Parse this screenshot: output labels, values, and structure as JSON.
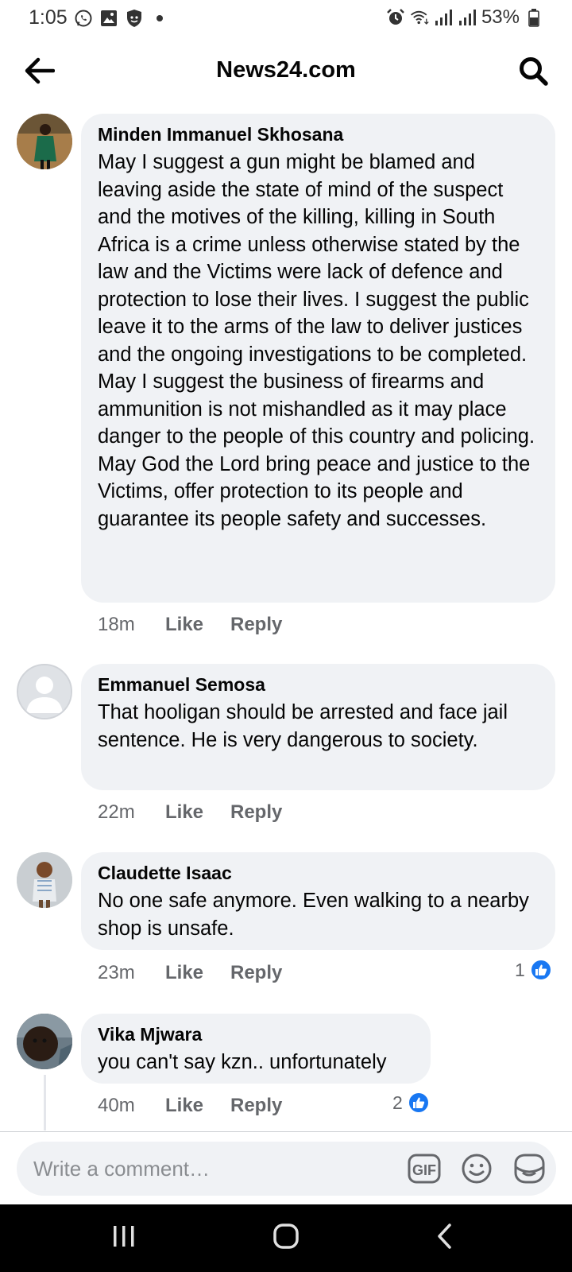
{
  "status_bar": {
    "time": "1:05",
    "left_icons": [
      "whatsapp-icon",
      "gallery-icon",
      "shield-icon",
      "dot-icon"
    ],
    "right_icons": [
      "alarm-icon",
      "wifi-icon",
      "signal-icon",
      "signal-icon"
    ],
    "battery_percent": "53%"
  },
  "header": {
    "title": "News24.com",
    "back_icon": "arrow-left-icon",
    "search_icon": "search-icon"
  },
  "comments": [
    {
      "author": "Minden Immanuel Skhosana",
      "text": "May I suggest a gun might be blamed and leaving aside the state of mind of the suspect and the motives of the killing, killing in South Africa is a crime unless otherwise stated by the law and the Victims were lack of defence and protection to lose their lives. I suggest the public leave it to the arms of the law to deliver justices and the ongoing investigations to be completed. May I suggest the business of firearms and ammunition is not mishandled as it may place danger to the people of this country and policing. May God the Lord bring peace and justice to the Victims, offer protection to its people and guarantee its people safety and successes.",
      "time": "18m",
      "like_label": "Like",
      "reply_label": "Reply",
      "reactions": ""
    },
    {
      "author": "Emmanuel Semosa",
      "text": "That hooligan should be arrested and face jail sentence. He is very dangerous to society.",
      "time": "22m",
      "like_label": "Like",
      "reply_label": "Reply",
      "reactions": ""
    },
    {
      "author": "Claudette Isaac",
      "text": "No one safe anymore. Even walking  to a nearby shop is unsafe.",
      "time": "23m",
      "like_label": "Like",
      "reply_label": "Reply",
      "reactions": "1"
    },
    {
      "author": "Vika Mjwara",
      "text": "you can't say kzn.. unfortunately",
      "time": "40m",
      "like_label": "Like",
      "reply_label": "Reply",
      "reactions": "2"
    }
  ],
  "composer": {
    "placeholder": "Write a comment…",
    "icons": [
      "gif-icon",
      "emoji-icon",
      "sticker-icon"
    ]
  },
  "nav_bar": {
    "icons": [
      "recent-apps-icon",
      "home-icon",
      "back-icon"
    ]
  },
  "colors": {
    "bubble": "#f0f2f5",
    "meta_text": "#65676b",
    "like_blue": "#1877f2",
    "nav_bg": "#000000"
  }
}
